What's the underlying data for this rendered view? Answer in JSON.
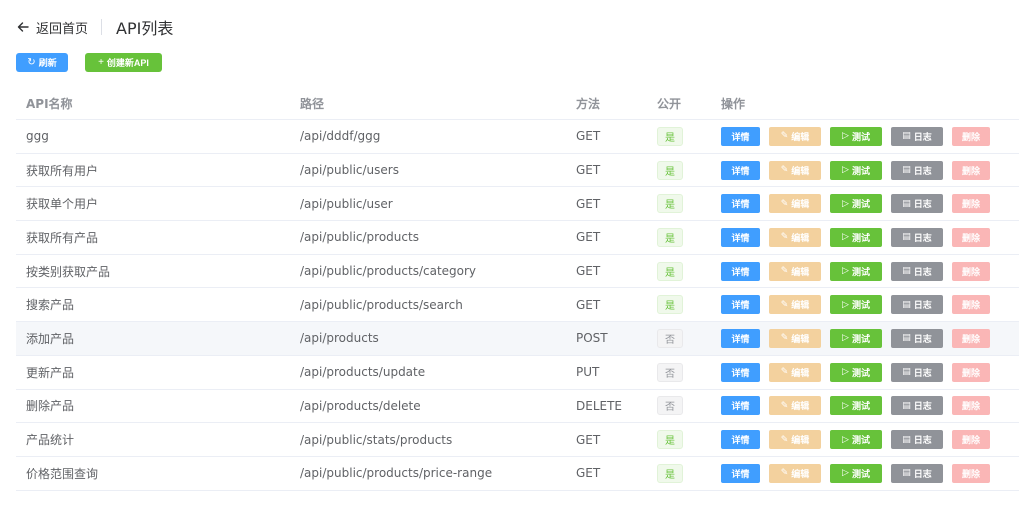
{
  "header": {
    "back_label": "返回首页",
    "title": "API列表"
  },
  "toolbar": {
    "refresh_label": "刷新",
    "create_label": "创建新API"
  },
  "table": {
    "columns": {
      "name": "API名称",
      "path": "路径",
      "method": "方法",
      "public": "公开",
      "actions": "操作"
    },
    "action_labels": {
      "detail": "详情",
      "edit": "编辑",
      "test": "测试",
      "log": "日志",
      "delete": "删除"
    },
    "rows": [
      {
        "name": "ggg",
        "path": "/api/dddf/ggg",
        "method": "GET",
        "public": "是"
      },
      {
        "name": "获取所有用户",
        "path": "/api/public/users",
        "method": "GET",
        "public": "是"
      },
      {
        "name": "获取单个用户",
        "path": "/api/public/user",
        "method": "GET",
        "public": "是"
      },
      {
        "name": "获取所有产品",
        "path": "/api/public/products",
        "method": "GET",
        "public": "是"
      },
      {
        "name": "按类别获取产品",
        "path": "/api/public/products/category",
        "method": "GET",
        "public": "是"
      },
      {
        "name": "搜索产品",
        "path": "/api/public/products/search",
        "method": "GET",
        "public": "是"
      },
      {
        "name": "添加产品",
        "path": "/api/products",
        "method": "POST",
        "public": "否",
        "highlighted": true
      },
      {
        "name": "更新产品",
        "path": "/api/products/update",
        "method": "PUT",
        "public": "否"
      },
      {
        "name": "删除产品",
        "path": "/api/products/delete",
        "method": "DELETE",
        "public": "否"
      },
      {
        "name": "产品统计",
        "path": "/api/public/stats/products",
        "method": "GET",
        "public": "是"
      },
      {
        "name": "价格范围查询",
        "path": "/api/public/products/price-range",
        "method": "GET",
        "public": "是"
      }
    ]
  },
  "colors": {
    "primary": "#409eff",
    "success": "#67c23a",
    "warning_light": "#f3d19e",
    "info": "#909399",
    "danger_light": "#fab6b6"
  }
}
